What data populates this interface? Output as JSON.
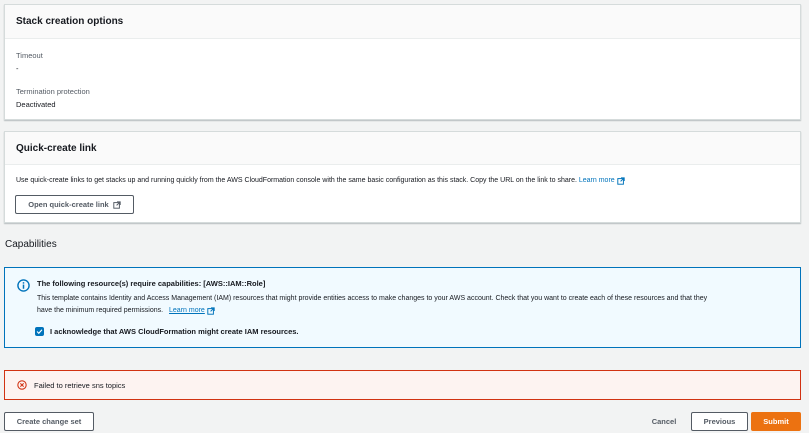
{
  "stack_options": {
    "title": "Stack creation options",
    "timeout_label": "Timeout",
    "timeout_value": "-",
    "termination_label": "Termination protection",
    "termination_value": "Deactivated"
  },
  "quick_create": {
    "title": "Quick-create link",
    "description": "Use quick-create links to get stacks up and running quickly from the AWS CloudFormation console with the same basic configuration as this stack. Copy the URL on the link to share.",
    "learn_more": "Learn more",
    "open_button": "Open quick-create link"
  },
  "capabilities": {
    "heading": "Capabilities",
    "info_title": "The following resource(s) require capabilities: [AWS::IAM::Role]",
    "info_body_line1": "This template contains Identity and Access Management (IAM) resources that might provide entities access to make changes to your AWS account. Check that you want to create each of these resources and that they",
    "info_body_line2": "have the minimum required permissions.",
    "learn_more": "Learn more",
    "acknowledge_label": "I acknowledge that AWS CloudFormation might create IAM resources.",
    "acknowledge_checked": true
  },
  "error": {
    "message": "Failed to retrieve sns topics"
  },
  "footer": {
    "create_change_set": "Create change set",
    "cancel": "Cancel",
    "previous": "Previous",
    "submit": "Submit"
  },
  "colors": {
    "link": "#0073bb",
    "primary": "#ec7211",
    "error": "#d13212",
    "info_border": "#0073bb"
  }
}
